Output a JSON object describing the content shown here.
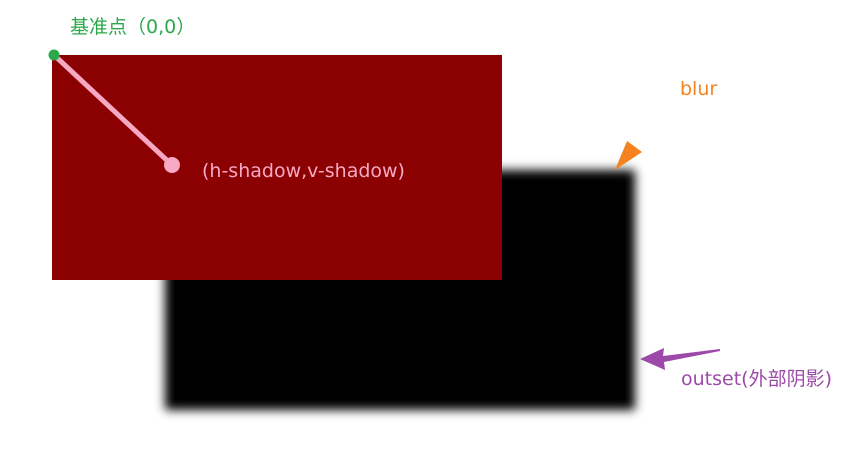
{
  "labels": {
    "origin": "基准点（0,0）",
    "offset": "(h-shadow,v-shadow)",
    "blur": "blur",
    "outset": "outset(外部阴影)"
  },
  "colors": {
    "box_fill": "#8b0000",
    "shadow_fill": "#000000",
    "origin_color": "#2aa84a",
    "offset_color": "#f7a9c4",
    "blur_color": "#f58220",
    "outset_color": "#9b4aa8",
    "background": "#ffffff"
  },
  "icons": {
    "blur_arrow": "arrow-pointing-down-left-icon",
    "outset_arrow": "arrow-pointing-left-icon",
    "origin_marker": "dot-icon",
    "offset_marker": "dot-icon"
  }
}
